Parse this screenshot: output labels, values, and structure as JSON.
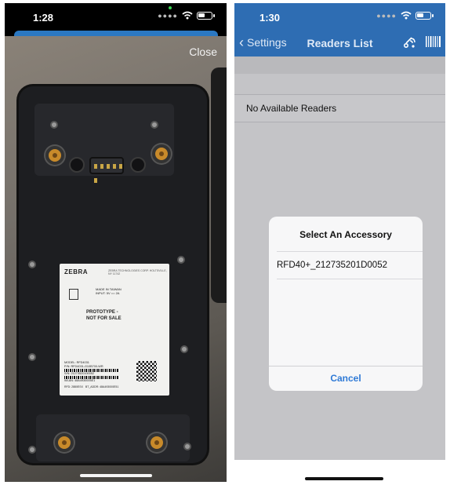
{
  "left_screen": {
    "status_time": "1:28",
    "close_label": "Close",
    "device_label": {
      "brand": "ZEBRA",
      "brand_sub": "ZEBRA TECHNOLOGIES CORP. HOLTSVILLE, NY 11742",
      "made_in": "MADE IN TAIWAN",
      "input": "INPUT: 5V == 2A",
      "prototype_line1": "PROTOTYPE -",
      "prototype_line2": "NOT FOR SALE",
      "model": "MODEL: RFD4031",
      "pn": "P/N: RFD4031-G10B700-WR",
      "sn": "S/N: 21273520100052",
      "wlan": "WLAN: 48A4930005E1",
      "bt": "BT_ADDR: 48A493000E51",
      "bottom": "RFD: 2880ESX"
    }
  },
  "right_screen": {
    "status_time": "1:30",
    "back_label": "Settings",
    "title": "Readers List",
    "no_readers_text": "No Available Readers",
    "alert": {
      "title": "Select An Accessory",
      "item": "RFD40+_212735201D0052",
      "cancel_label": "Cancel"
    }
  },
  "icons": {
    "wifi": "wifi-icon",
    "battery": "battery-icon",
    "back": "chevron-left-icon",
    "connect": "rfid-connect-icon",
    "barcode": "barcode-scan-icon"
  },
  "colors": {
    "nav_blue": "#2e6db3",
    "link_blue": "#2f7ad6",
    "dim_overlay": "#c4c4c7"
  }
}
